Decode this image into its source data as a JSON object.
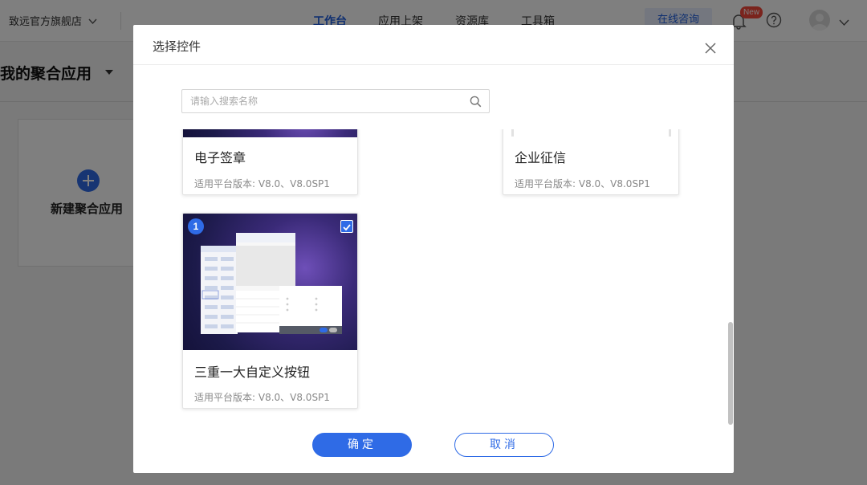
{
  "header": {
    "store_name": "致远官方旗舰店",
    "nav": [
      "工作台",
      "应用上架",
      "资源库",
      "工具箱"
    ],
    "consult_label": "在线咨询",
    "new_badge": "New"
  },
  "page": {
    "title": "我的聚合应用",
    "new_app_label": "新建聚合应用"
  },
  "modal": {
    "title": "选择控件",
    "search_placeholder": "请输入搜索名称",
    "cards": [
      {
        "name": "电子签章",
        "meta": "适用平台版本: V8.0、V8.0SP1",
        "selected": false
      },
      {
        "name": "企业征信",
        "meta": "适用平台版本: V8.0、V8.0SP1",
        "selected": false
      },
      {
        "name": "三重一大自定义按钮",
        "meta": "适用平台版本: V8.0、V8.0SP1",
        "selected": true,
        "order": "1"
      }
    ],
    "confirm_label": "确定",
    "cancel_label": "取消"
  },
  "colors": {
    "accent": "#2f6be6",
    "badge": "#f5483b"
  }
}
